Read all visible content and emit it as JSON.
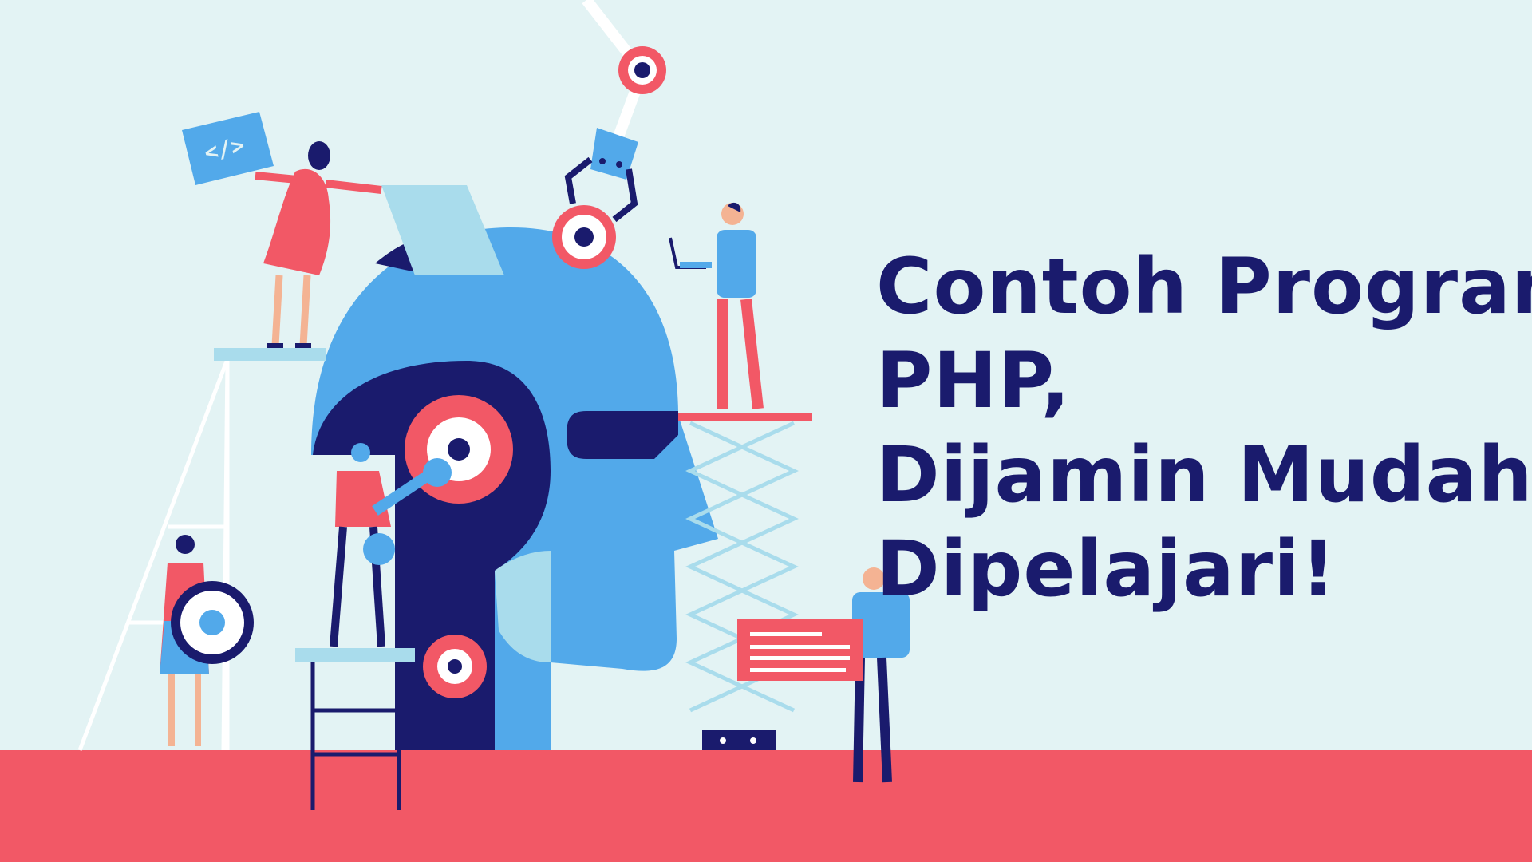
{
  "headline": {
    "lines": [
      "Contoh Program",
      "PHP,",
      "Dijamin Mudah",
      "Dipelajari!"
    ]
  },
  "code_sign": {
    "text": "</>"
  },
  "colors": {
    "background": "#e3f3f4",
    "floor": "#f25866",
    "navy": "#1a1b6d",
    "blue": "#52a9ea",
    "light_blue": "#a9dcec",
    "coral": "#f25866",
    "white": "#ffffff"
  },
  "illustration": {
    "subject": "robot-head-being-built-by-people",
    "icons": [
      "gear-icon",
      "code-sign-icon",
      "laptop-icon",
      "wrench-icon",
      "robot-arm-icon",
      "document-board-icon"
    ]
  }
}
